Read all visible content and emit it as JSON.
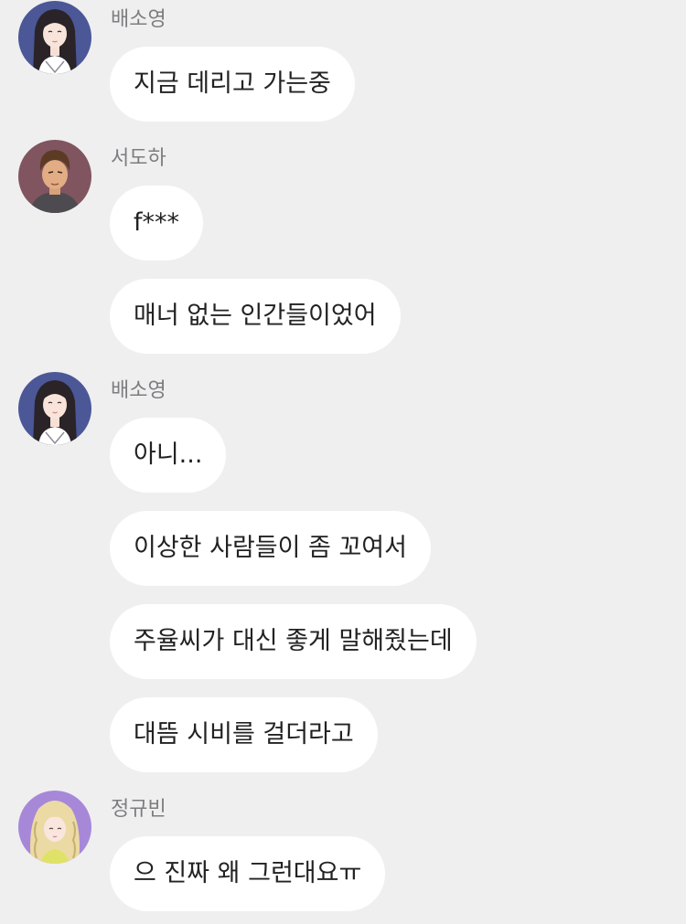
{
  "colors": {
    "background": "#efeff0",
    "bubble": "#ffffff",
    "sender_name": "#7d7d80",
    "message_text": "#222222"
  },
  "chat": {
    "groups": [
      {
        "sender": "배소영",
        "avatar_icon": "avatar-bae-soyoung",
        "messages": [
          "지금 데리고 가는중"
        ]
      },
      {
        "sender": "서도하",
        "avatar_icon": "avatar-seo-doha",
        "messages": [
          "f***",
          "매너 없는 인간들이었어"
        ]
      },
      {
        "sender": "배소영",
        "avatar_icon": "avatar-bae-soyoung",
        "messages": [
          "아니...",
          "이상한 사람들이 좀 꼬여서",
          "주율씨가 대신 좋게 말해줬는데",
          "대뜸 시비를 걸더라고"
        ]
      },
      {
        "sender": "정규빈",
        "avatar_icon": "avatar-jung-gyubin",
        "messages": [
          "으 진짜 왜 그런대요ㅠ"
        ]
      }
    ]
  }
}
